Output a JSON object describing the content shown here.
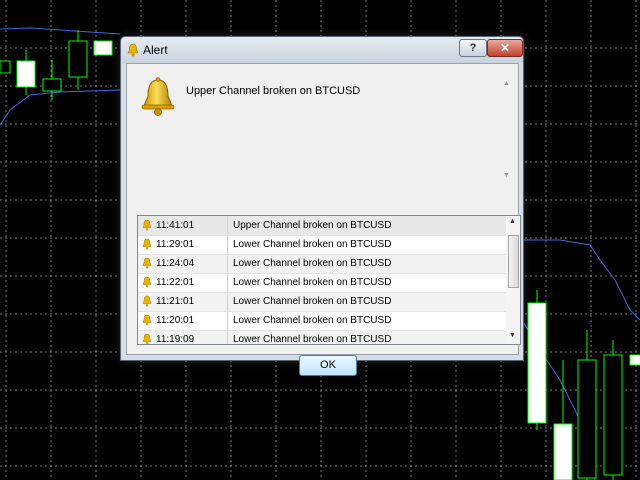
{
  "background": {
    "grid_color": "#7a7a7a",
    "candle_outline": "#00ff00",
    "candle_fill": "#ffffff",
    "channel_line_color": "#4169e1"
  },
  "dialog": {
    "title": "Alert",
    "help_button_label": "?",
    "close_button_label": "✕",
    "message": "Upper Channel broken on BTCUSD",
    "ok_label": "OK",
    "icon": "bell-icon"
  },
  "alerts": [
    {
      "time": "11:41:01",
      "text": "Upper Channel broken on BTCUSD"
    },
    {
      "time": "11:29:01",
      "text": "Lower Channel broken on BTCUSD"
    },
    {
      "time": "11:24:04",
      "text": "Lower Channel broken on BTCUSD"
    },
    {
      "time": "11:22:01",
      "text": "Lower Channel broken on BTCUSD"
    },
    {
      "time": "11:21:01",
      "text": "Lower Channel broken on BTCUSD"
    },
    {
      "time": "11:20:01",
      "text": "Lower Channel broken on BTCUSD"
    },
    {
      "time": "11:19:09",
      "text": "Lower Channel broken on BTCUSD"
    }
  ]
}
